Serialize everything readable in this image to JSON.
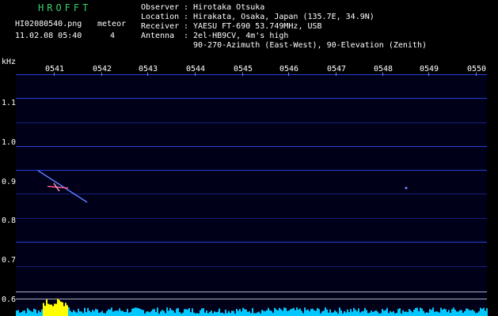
{
  "header": {
    "logo": "HROFFT",
    "filename": "HI02080540.png",
    "datetime": "11.02.08 05:40",
    "meteor_label": "meteor",
    "meteor_count": "4"
  },
  "info": {
    "observer": {
      "label": "Observer",
      "value": "Hirotaka Otsuka"
    },
    "location": {
      "label": "Location",
      "value": "Hirakata, Osaka, Japan (135.7E, 34.9N)"
    },
    "receiver": {
      "label": "Receiver",
      "value": "YAESU FT-690 53.749MHz, USB"
    },
    "antenna": {
      "label": "Antenna",
      "value": "2el-HB9CV, 4m's high"
    },
    "antenna2": "90-270-Azimuth (East-West), 90-Elevation (Zenith)"
  },
  "axis": {
    "y_unit": "kHz",
    "x_ticks": [
      "0541",
      "0542",
      "0543",
      "0544",
      "0545",
      "0546",
      "0547",
      "0548",
      "0549",
      "0550"
    ],
    "y_ticks": [
      "1.1",
      "1.0",
      "0.9",
      "0.8",
      "0.7",
      "0.6"
    ]
  },
  "colors": {
    "logo": "#38d36a",
    "line": "#2a4dff",
    "bg": "#000018",
    "noise": "#00c8ff",
    "meteor": "#ffff00"
  }
}
